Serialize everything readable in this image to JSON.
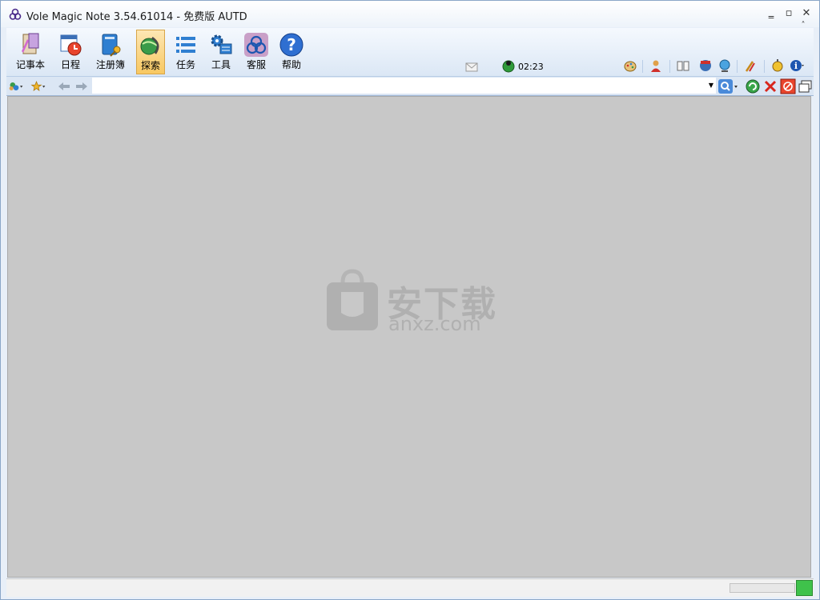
{
  "window": {
    "title": "Vole Magic Note  3.54.61014 - 免费版 AUTD",
    "minimize_glyph": "‗",
    "maximize_glyph": "▫",
    "close_glyph": "✕",
    "collapse_glyph": "˄"
  },
  "ribbon": {
    "buttons": [
      {
        "label": "记事本",
        "icon": "notepad-icon"
      },
      {
        "label": "日程",
        "icon": "calendar-clock-icon"
      },
      {
        "label": "注册簿",
        "icon": "register-book-icon"
      },
      {
        "label": "探索",
        "icon": "explore-globe-icon"
      },
      {
        "label": "任务",
        "icon": "task-list-icon"
      },
      {
        "label": "工具",
        "icon": "tools-gear-icon"
      },
      {
        "label": "客服",
        "icon": "service-logo-icon"
      },
      {
        "label": "帮助",
        "icon": "help-icon"
      }
    ],
    "active": "探索",
    "clock": "02:23"
  },
  "nav": {
    "address_value": "",
    "address_placeholder": ""
  },
  "watermark": {
    "cn": "安下载",
    "url": "anxz.com"
  },
  "status": {
    "progress": 0
  }
}
